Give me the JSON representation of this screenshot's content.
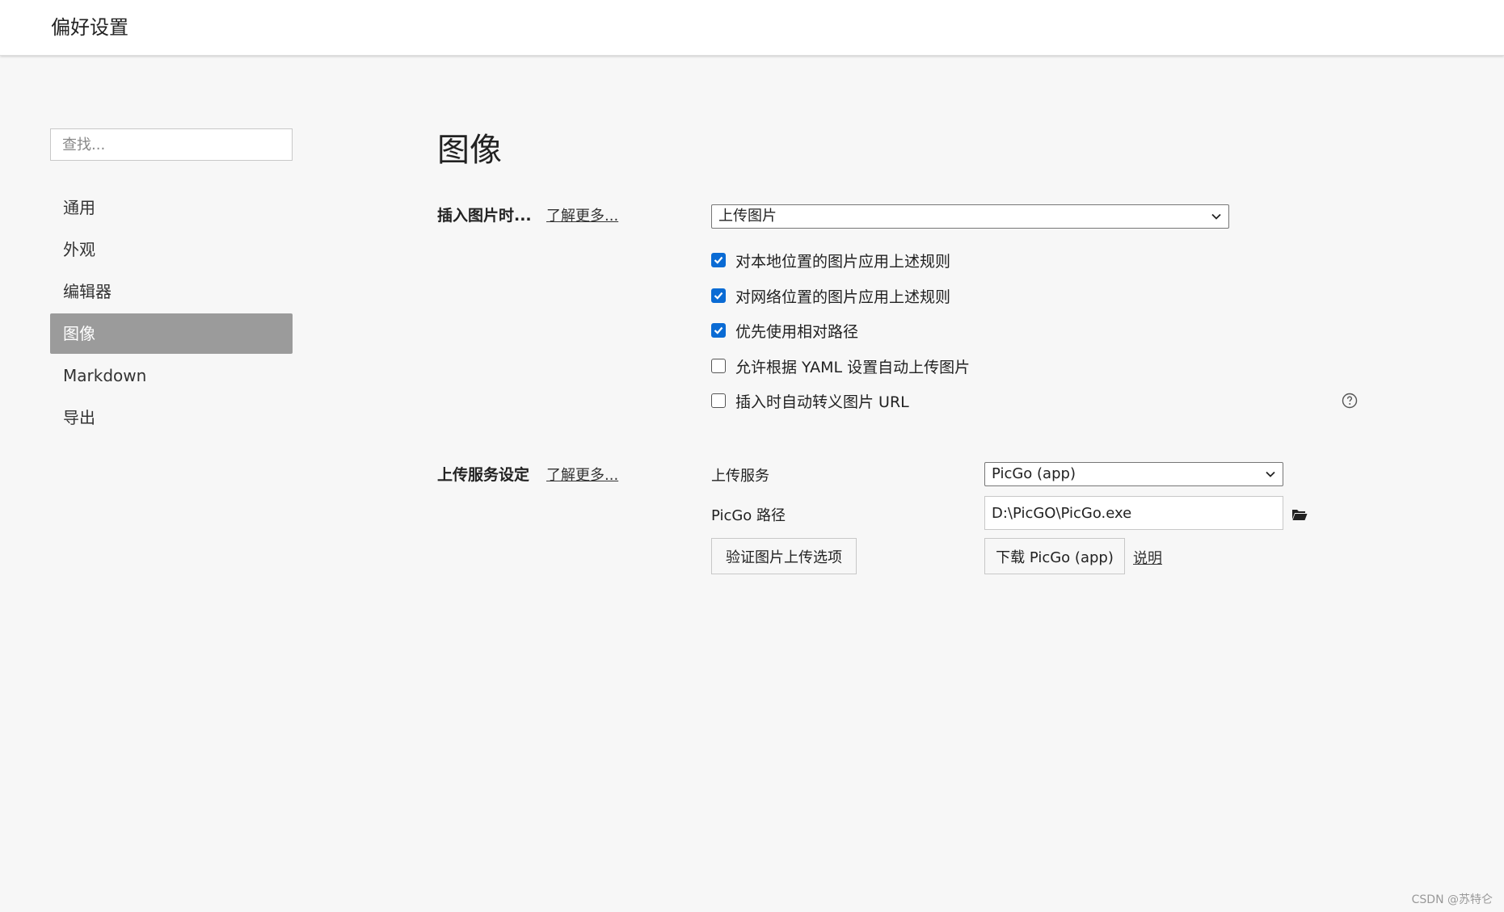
{
  "window": {
    "title": "偏好设置"
  },
  "search": {
    "placeholder": "查找..."
  },
  "sidebar": {
    "items": [
      {
        "label": "通用",
        "active": false
      },
      {
        "label": "外观",
        "active": false
      },
      {
        "label": "编辑器",
        "active": false
      },
      {
        "label": "图像",
        "active": true
      },
      {
        "label": "Markdown",
        "active": false
      },
      {
        "label": "导出",
        "active": false
      }
    ]
  },
  "main": {
    "title": "图像",
    "insert_section": {
      "label": "插入图片时...",
      "learn_more": "了解更多...",
      "action_select": "上传图片",
      "options": [
        {
          "label": "对本地位置的图片应用上述规则",
          "checked": true
        },
        {
          "label": "对网络位置的图片应用上述规则",
          "checked": true
        },
        {
          "label": "优先使用相对路径",
          "checked": true
        },
        {
          "label": "允许根据 YAML 设置自动上传图片",
          "checked": false
        },
        {
          "label": "插入时自动转义图片 URL",
          "checked": false
        }
      ],
      "help_icon": "question-circle-icon"
    },
    "upload_section": {
      "label": "上传服务设定",
      "learn_more": "了解更多...",
      "service_label": "上传服务",
      "service_value": "PicGo (app)",
      "path_label": "PicGo 路径",
      "path_value": "D:\\PicGO\\PicGo.exe",
      "verify_button": "验证图片上传选项",
      "download_button": "下载 PicGo (app)",
      "docs_link": "说明",
      "folder_icon": "folder-icon"
    }
  },
  "watermark": "CSDN @苏特仑",
  "colors": {
    "accent": "#0a6bd4",
    "active_nav": "#9b9b9b",
    "background": "#f7f7f7"
  }
}
